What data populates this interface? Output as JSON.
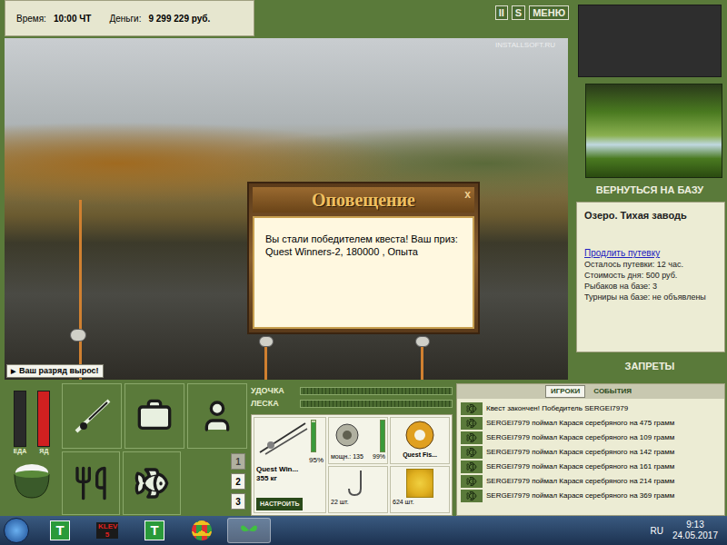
{
  "status": {
    "time_label": "Время:",
    "time": "10:00 ЧТ",
    "money_label": "Деньги:",
    "money": "9 299 229 руб."
  },
  "top_buttons": [
    "II",
    "S",
    "МЕНЮ"
  ],
  "watermark": "INSTALLSOFT.RU",
  "toast": "Ваш разряд вырос!",
  "dialog": {
    "title": "Оповещение",
    "close": "x",
    "message": "Вы стали победителем квеста! Ваш приз: Quest Winners-2, 180000 , Опыта"
  },
  "location": {
    "back_button": "ВЕРНУТЬСЯ НА БАЗУ",
    "name": "Озеро. Тихая заводь",
    "extend_link": "Продлить путевку",
    "lines": [
      "Осталось путевки: 12 час.",
      "Стоимость дня: 500 руб.",
      "Рыбаков на базе: 3",
      "Турниры на базе: не объявлены"
    ],
    "bans_button": "ЗАПРЕТЫ"
  },
  "meters": [
    {
      "label": "ЕДА",
      "level": 0,
      "color": "#3a9a3a"
    },
    {
      "label": "ЯД",
      "level": 1,
      "color": "#d02020"
    }
  ],
  "pages": [
    {
      "label": "1",
      "selected": true
    },
    {
      "label": "2",
      "selected": false
    },
    {
      "label": "3",
      "selected": false
    }
  ],
  "gear_bars": [
    {
      "label": "УДОЧКА",
      "level": 0
    },
    {
      "label": "ЛЕСКА",
      "level": 0
    }
  ],
  "rod": {
    "name": "Quest Win...",
    "weight": "355 кг",
    "condition": "95%",
    "level": 0.95,
    "button": "НАСТРОИТЬ"
  },
  "reel": {
    "power": "мощн.: 135",
    "condition": "99%",
    "level": 0.99
  },
  "line": {
    "name": "Quest Fis..."
  },
  "hook": {
    "count": "22 шт."
  },
  "bait": {
    "count": "624 шт."
  },
  "feed": {
    "tabs": [
      {
        "label": "ИГРОКИ",
        "selected": true
      },
      {
        "label": "СОБЫТИЯ",
        "selected": false
      }
    ],
    "messages": [
      "Квест закончен! Победитель SERGEI7979",
      "SERGEI7979 поймал Карася серебряного на 475 грамм",
      "SERGEI7979 поймал Карася серебряного на 109 грамм",
      "SERGEI7979 поймал Карася серебряного на 142 грамм",
      "SERGEI7979 поймал Карася серебряного на 161 грамм",
      "SERGEI7979 поймал Карася серебряного на 214 грамм",
      "SERGEI7979 поймал Карася серебряного на 369 грамм"
    ]
  },
  "taskbar": {
    "apps": [
      "T",
      "KLEV 5",
      "T"
    ],
    "language": "RU",
    "time": "9:13",
    "date": "24.05.2017"
  }
}
